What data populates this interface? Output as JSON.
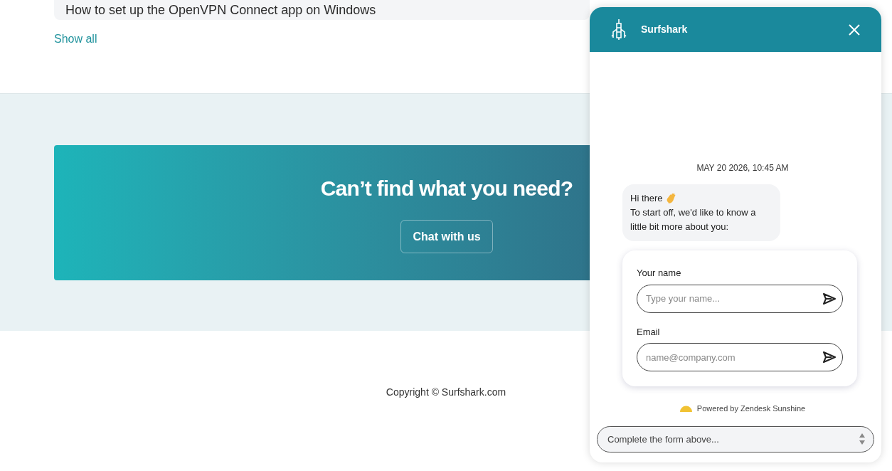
{
  "article_row": {
    "title": "How to set up the OpenVPN Connect app on Windows"
  },
  "show_all": "Show all",
  "banner": {
    "heading": "Can’t find what you need?",
    "button": "Chat with us"
  },
  "footer": {
    "copyright": "Copyright © Surfshark.com"
  },
  "chat": {
    "title": "Surfshark",
    "timestamp": "MAY 20 2026, 10:45 AM",
    "greeting": "Hi there",
    "message": "To start off, we'd like to know a little bit more about you:",
    "fields": [
      {
        "label": "Your name",
        "placeholder": "Type your name..."
      },
      {
        "label": "Email",
        "placeholder": "name@company.com"
      }
    ],
    "powered_by": "Powered by Zendesk Sunshine",
    "composer": {
      "placeholder": "Complete the form above..."
    }
  }
}
